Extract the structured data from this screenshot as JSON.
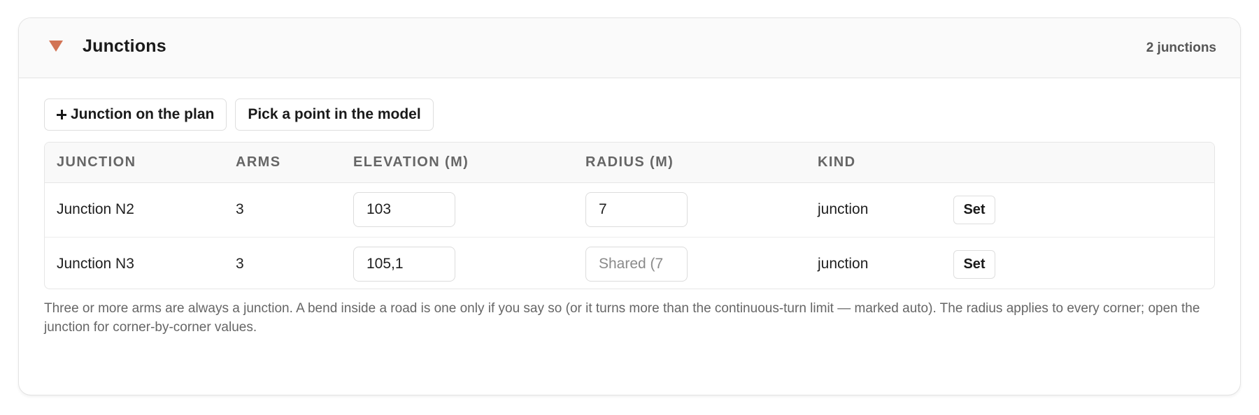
{
  "panel": {
    "title": "Junctions",
    "count": "2 junctions",
    "accent_color": "#d27455"
  },
  "toolbar": {
    "add_junction_label": "Junction on the plan",
    "pick_point_label": "Pick a point in the model"
  },
  "table": {
    "headers": {
      "junction": "JUNCTION",
      "arms": "ARMS",
      "elevation": "ELEVATION (M)",
      "radius": "RADIUS (M)",
      "kind": "KIND"
    },
    "rows": [
      {
        "name": "Junction N2",
        "arms": "3",
        "elevation": "103",
        "radius_value": "7",
        "radius_placeholder": "",
        "kind": "junction",
        "action": "Set"
      },
      {
        "name": "Junction N3",
        "arms": "3",
        "elevation": "105,1",
        "radius_value": "",
        "radius_placeholder": "Shared (7",
        "kind": "junction",
        "action": "Set"
      }
    ]
  },
  "footnote": "Three or more arms are always a junction. A bend inside a road is one only if you say so (or it turns more than the continuous-turn limit — marked auto). The radius applies to every corner; open the junction for corner-by-corner values."
}
